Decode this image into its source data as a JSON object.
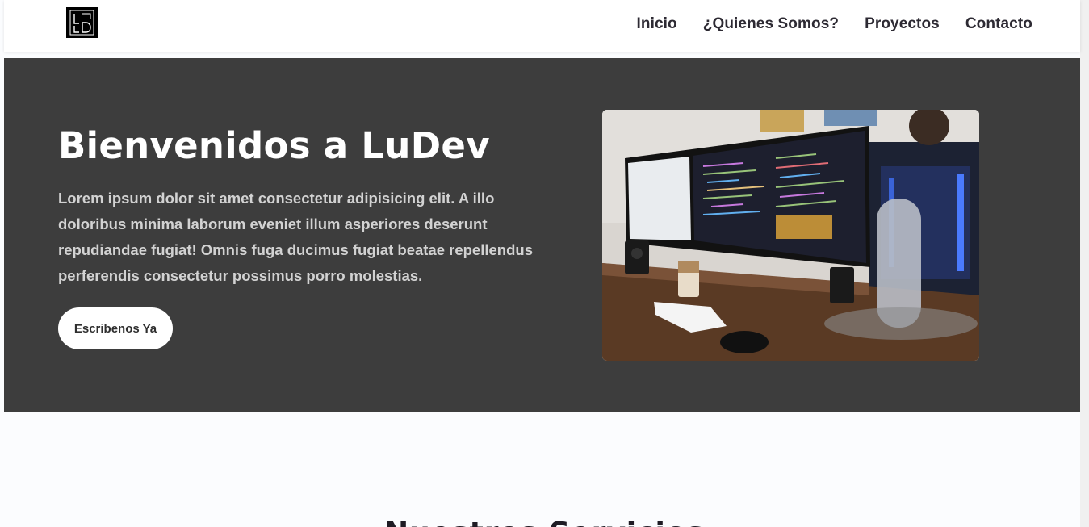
{
  "header": {
    "logo_alt": "LD",
    "nav": [
      {
        "label": "Inicio"
      },
      {
        "label": "¿Quienes Somos?"
      },
      {
        "label": "Proyectos"
      },
      {
        "label": "Contacto"
      }
    ]
  },
  "hero": {
    "title": "Bienvenidos a LuDev",
    "text": "Lorem ipsum dolor sit amet consectetur adipisicing elit. A illo doloribus minima laborum eveniet illum asperiores deserunt repudiandae fugiat! Omnis fuga ducimus fugiat beatae repellendus perferendis consectetur possimus porro molestias.",
    "button_label": "Escribenos Ya",
    "image_icon": "workspace-photo"
  },
  "services": {
    "heading": "Nuestros Servicios"
  },
  "colors": {
    "hero_bg": "#3d3d3d",
    "nav_text": "#2d2a33",
    "button_bg": "#ffffff"
  }
}
